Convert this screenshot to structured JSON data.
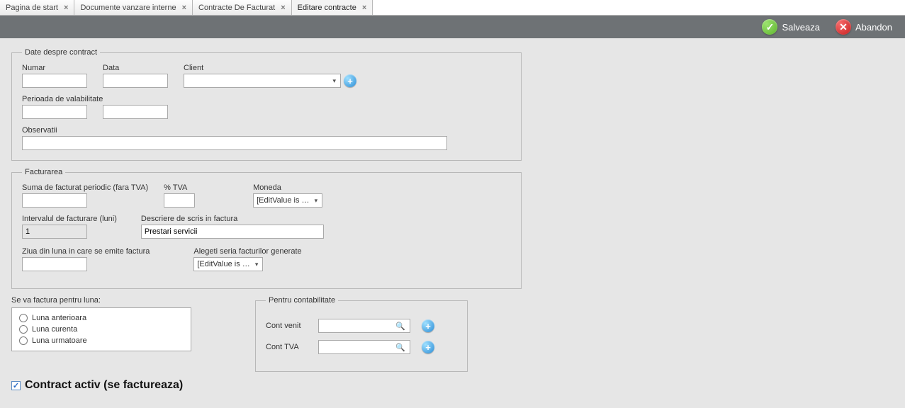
{
  "tabs": [
    {
      "label": "Pagina de start",
      "active": false
    },
    {
      "label": "Documente vanzare interne",
      "active": false
    },
    {
      "label": "Contracte De Facturat",
      "active": false
    },
    {
      "label": "Editare contracte",
      "active": true
    }
  ],
  "toolbar": {
    "save": "Salveaza",
    "abandon": "Abandon"
  },
  "contract": {
    "legend": "Date despre contract",
    "numar_label": "Numar",
    "numar": "",
    "data_label": "Data",
    "data": "",
    "client_label": "Client",
    "client": "",
    "perioada_label": "Perioada de valabilitate",
    "perioada_from": "",
    "perioada_to": "",
    "observatii_label": "Observatii",
    "observatii": ""
  },
  "facturarea": {
    "legend": "Facturarea",
    "suma_label": "Suma de facturat periodic (fara TVA)",
    "suma": "",
    "tva_label": "% TVA",
    "tva": "",
    "moneda_label": "Moneda",
    "moneda": "[EditValue is …",
    "interval_label": "Intervalul de facturare (luni)",
    "interval": "1",
    "descriere_label": "Descriere de scris in factura",
    "descriere": "Prestari servicii",
    "ziua_label": "Ziua din luna in care se emite factura",
    "ziua": "",
    "serie_label": "Alegeti seria facturilor generate",
    "serie": "[EditValue is …"
  },
  "factura_luna": {
    "title": "Se va factura pentru luna:",
    "opt1": "Luna anterioara",
    "opt2": "Luna curenta",
    "opt3": "Luna urmatoare"
  },
  "contab": {
    "legend": "Pentru contabilitate",
    "venit_label": "Cont venit",
    "venit": "",
    "tva_label": "Cont TVA",
    "tva": ""
  },
  "activ_label": "Contract activ (se factureaza)",
  "activ_checked": true
}
